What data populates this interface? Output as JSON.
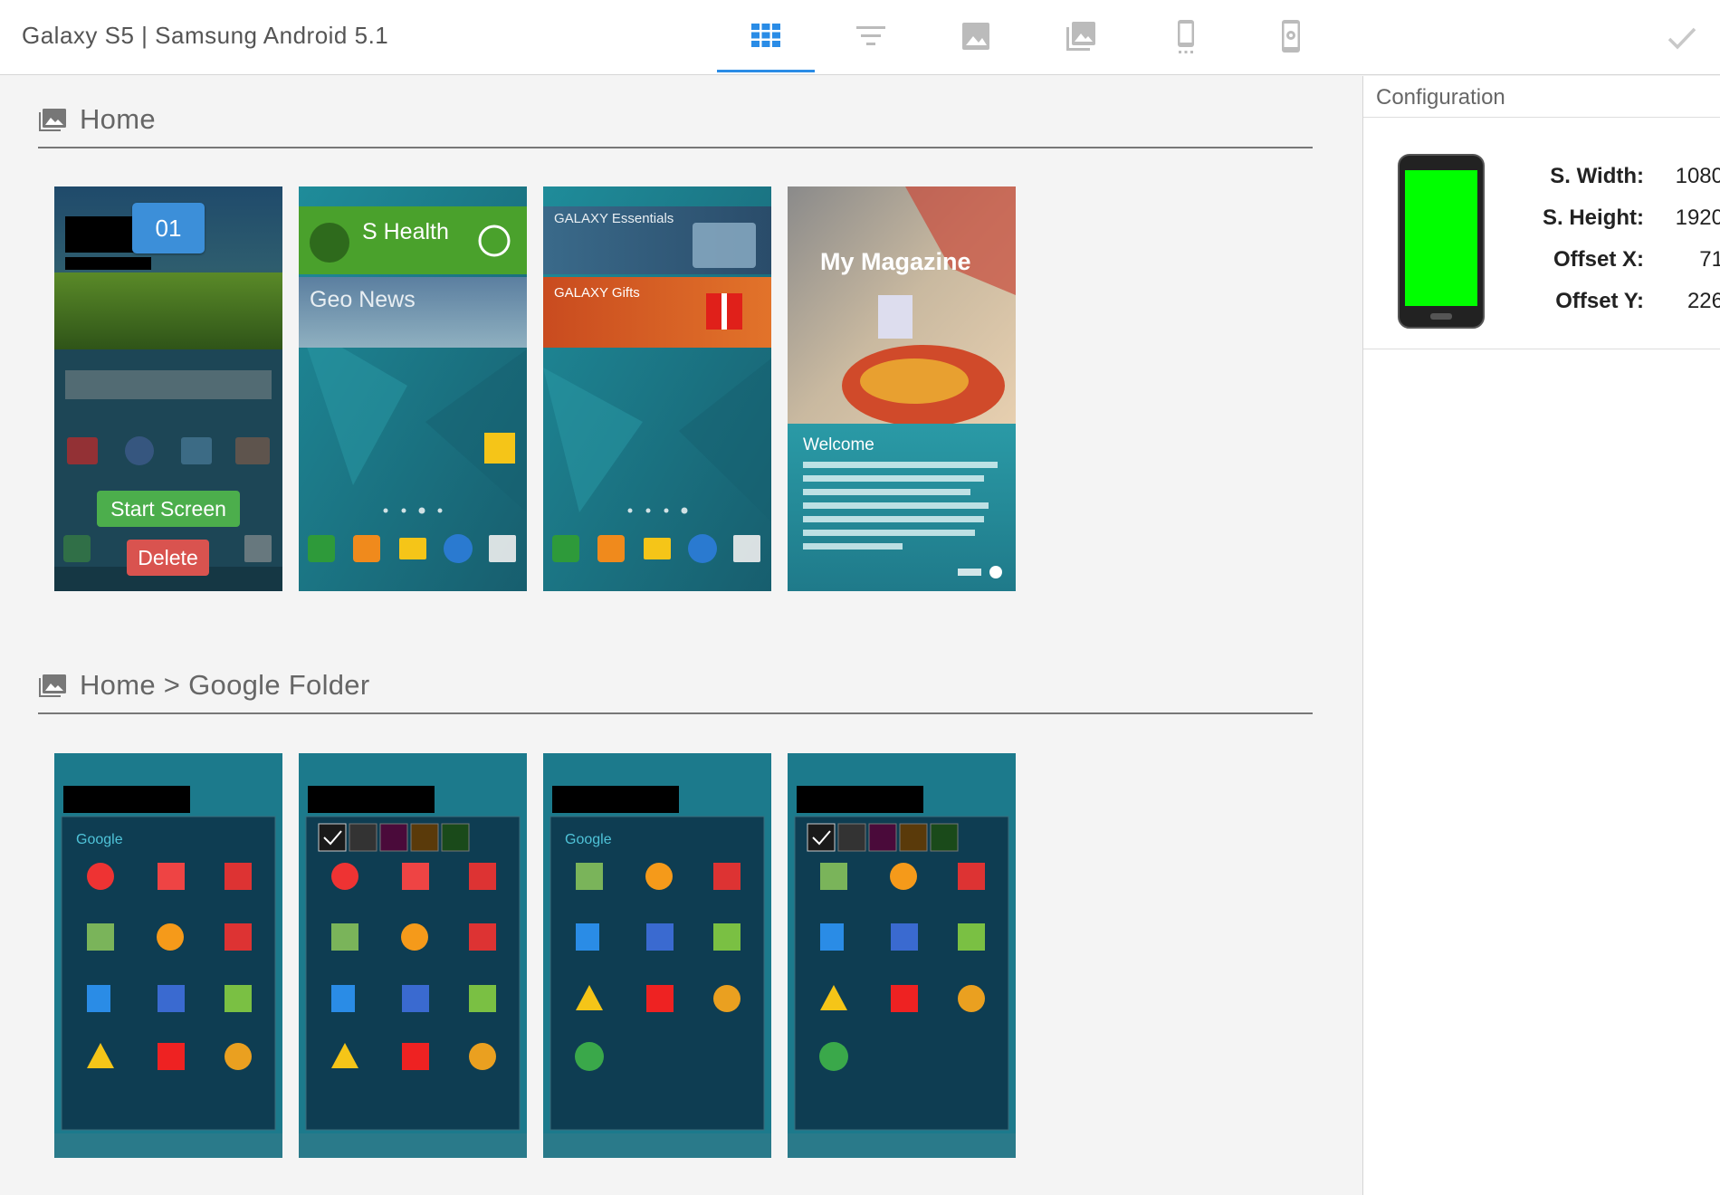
{
  "header": {
    "title": "Galaxy S5 | Samsung Android 5.1",
    "tools": [
      {
        "name": "grid-view-icon",
        "active": true
      },
      {
        "name": "filter-icon",
        "active": false
      },
      {
        "name": "image-icon",
        "active": false
      },
      {
        "name": "image-library-icon",
        "active": false
      },
      {
        "name": "phone-icon",
        "active": false
      },
      {
        "name": "phone-settings-icon",
        "active": false
      }
    ],
    "confirm_icon": "checkmark-icon"
  },
  "sections": [
    {
      "title": "Home",
      "screens": [
        {
          "label": "home-screen-weather",
          "badge": "01",
          "start_label": "Start Screen",
          "delete_label": "Delete"
        },
        {
          "label": "home-screen-shealth",
          "tiles": [
            "S Health",
            "Geo News"
          ]
        },
        {
          "label": "home-screen-galaxy",
          "tiles": [
            "GALAXY Essentials",
            "GALAXY Gifts"
          ]
        },
        {
          "label": "home-screen-magazine",
          "title": "My Magazine",
          "welcome": "Welcome"
        }
      ]
    },
    {
      "title": "Home > Google Folder",
      "screens": [
        {
          "label": "google-folder-1",
          "folder_name": "Google"
        },
        {
          "label": "google-folder-2"
        },
        {
          "label": "google-folder-3",
          "folder_name": "Google"
        },
        {
          "label": "google-folder-4"
        }
      ]
    }
  ],
  "configuration": {
    "title": "Configuration",
    "rows": [
      {
        "label": "S. Width:",
        "value": "1080"
      },
      {
        "label": "S. Height:",
        "value": "1920"
      },
      {
        "label": "Offset X:",
        "value": "71"
      },
      {
        "label": "Offset Y:",
        "value": "226"
      }
    ],
    "screen_color": "#00ff00"
  },
  "colors": {
    "accent": "#2a8ce6",
    "start": "#4cae4c",
    "delete": "#d9534f",
    "badge": "#3c8fd9"
  }
}
